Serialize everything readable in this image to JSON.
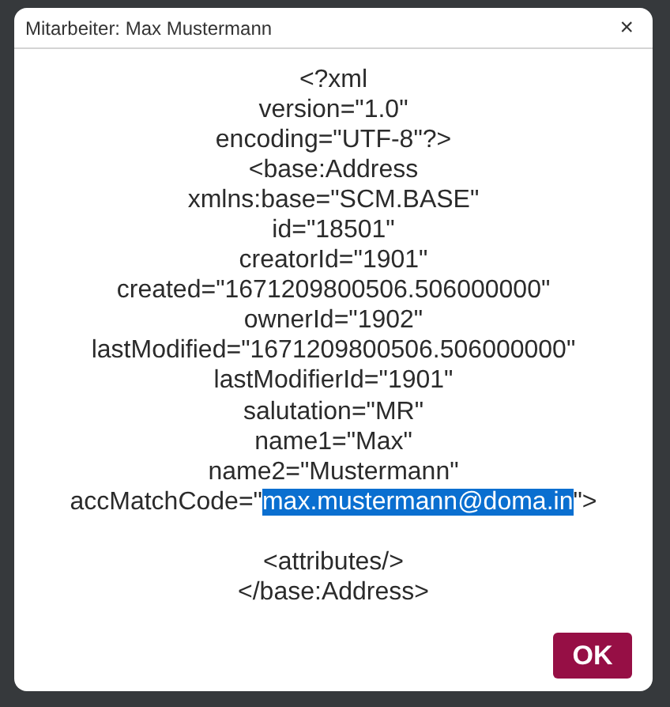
{
  "window": {
    "title": "Mitarbeiter: Max Mustermann",
    "close": "×"
  },
  "lines": [
    {
      "kind": "text",
      "text": "<?xml"
    },
    {
      "kind": "text",
      "text": "version=\"1.0\""
    },
    {
      "kind": "text",
      "text": "encoding=\"UTF-8\"?>"
    },
    {
      "kind": "text",
      "text": "<base:Address"
    },
    {
      "kind": "text",
      "text": "xmlns:base=\"SCM.BASE\""
    },
    {
      "kind": "text",
      "text": "id=\"18501\""
    },
    {
      "kind": "text",
      "text": "creatorId=\"1901\""
    },
    {
      "kind": "text",
      "text": "created=\"1671209800506.506000000\""
    },
    {
      "kind": "text",
      "text": "ownerId=\"1902\""
    },
    {
      "kind": "text",
      "text": "lastModified=\"1671209800506.506000000\""
    },
    {
      "kind": "text",
      "text": "lastModifierId=\"1901\""
    },
    {
      "kind": "text",
      "text": "salutation=\"MR\""
    },
    {
      "kind": "text",
      "text": "name1=\"Max\""
    },
    {
      "kind": "text",
      "text": "name2=\"Mustermann\""
    },
    {
      "kind": "selection",
      "before": "accMatchCode=\"",
      "selected": "max.mustermann@doma.in",
      "after": "\">"
    },
    {
      "kind": "blank"
    },
    {
      "kind": "text",
      "text": "<attributes/>"
    },
    {
      "kind": "text",
      "text": "</base:Address>"
    }
  ],
  "buttons": [
    "OK"
  ]
}
